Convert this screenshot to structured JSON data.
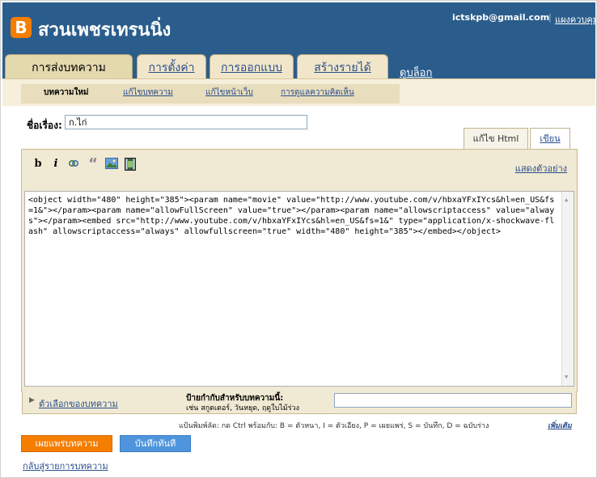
{
  "header": {
    "logo_letter": "B",
    "blog_title": "สวนเพชรเทรนนิ่ง",
    "user_email": "ictskpb@gmail.com",
    "separator": "|",
    "dashboard_link": "แผงควบคุม"
  },
  "tabs": [
    {
      "label": "การส่งบทความ",
      "active": true
    },
    {
      "label": "การตั้งค่า",
      "active": false
    },
    {
      "label": "การออกแบบ",
      "active": false
    },
    {
      "label": "สร้างรายได้",
      "active": false
    }
  ],
  "view_blog": "ดูบล็อก",
  "subtabs": [
    {
      "label": "บทความใหม่",
      "active": true
    },
    {
      "label": "แก้ไขบทความ",
      "active": false
    },
    {
      "label": "แก้ไขหน้าเว็บ",
      "active": false
    },
    {
      "label": "การดูแลความคิดเห็น",
      "active": false
    }
  ],
  "post": {
    "title_label": "ชื่อเรื่อง:",
    "title_value": "ก.ไก่"
  },
  "editor_modes": {
    "html": "แก้ไข Html",
    "compose": "เขียน"
  },
  "toolbar": {
    "bold": "b",
    "italic": "i",
    "link_icon": "link-icon",
    "quote": "“",
    "image_icon": "image-icon",
    "video_icon": "video-icon",
    "preview": "แสดงตัวอย่าง"
  },
  "editor_content": "<object width=\"480\" height=\"385\"><param name=\"movie\" value=\"http://www.youtube.com/v/hbxaYFxIYcs&hl=en_US&fs=1&\"></param><param name=\"allowFullScreen\" value=\"true\"></param><param name=\"allowscriptaccess\" value=\"always\"></param><embed src=\"http://www.youtube.com/v/hbxaYFxIYcs&hl=en_US&fs=1&\" type=\"application/x-shockwave-flash\" allowscriptaccess=\"always\" allowfullscreen=\"true\" width=\"480\" height=\"385\"></embed></object>",
  "options": {
    "post_options": "ตัวเลือกของบทความ",
    "labels_title": "ป้ายกำกับสำหรับบทความนี้:",
    "labels_hint": "เช่น สกูตเตอร์, วันหยุด, ฤดูใบไม้ร่วง"
  },
  "shortcuts": {
    "text": "แป้นพิมพ์ลัด: กด Ctrl พร้อมกับ: B = ตัวหนา, I = ตัวเอียง, P = เผยแพร่, S = บันทึก, D = ฉบับร่าง",
    "more": "เพิ่มเติม"
  },
  "buttons": {
    "publish": "เผยแพร่บทความ",
    "save": "บันทึกทันที"
  },
  "back_link": "กลับสู่รายการบทความ",
  "colors": {
    "header": "#2b5d8c",
    "publish": "#f57d00",
    "save": "#4e95dd",
    "tab_bg": "#f1e6c9"
  }
}
